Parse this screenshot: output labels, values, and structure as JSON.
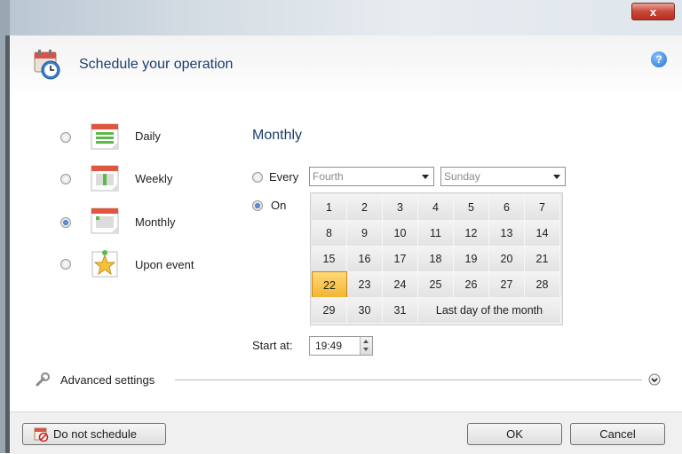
{
  "window": {
    "close_glyph": "x"
  },
  "header": {
    "title": "Schedule your operation",
    "help_glyph": "?"
  },
  "options": [
    {
      "label": "Daily",
      "checked": false,
      "icon": "calendar-daily-icon"
    },
    {
      "label": "Weekly",
      "checked": false,
      "icon": "calendar-weekly-icon"
    },
    {
      "label": "Monthly",
      "checked": true,
      "icon": "calendar-monthly-icon"
    },
    {
      "label": "Upon event",
      "checked": false,
      "icon": "event-star-icon"
    }
  ],
  "monthly": {
    "title": "Monthly",
    "every_label": "Every",
    "every_checked": false,
    "week_select": "Fourth",
    "day_select": "Sunday",
    "on_label": "On",
    "on_checked": true,
    "days": [
      "1",
      "2",
      "3",
      "4",
      "5",
      "6",
      "7",
      "8",
      "9",
      "10",
      "11",
      "12",
      "13",
      "14",
      "15",
      "16",
      "17",
      "18",
      "19",
      "20",
      "21",
      "22",
      "23",
      "24",
      "25",
      "26",
      "27",
      "28",
      "29",
      "30",
      "31"
    ],
    "last_day_label": "Last day of the month",
    "selected_day": "22",
    "start_label": "Start at:",
    "start_time": "19:49"
  },
  "advanced": {
    "label": "Advanced settings"
  },
  "footer": {
    "do_not_schedule": "Do not schedule",
    "ok": "OK",
    "cancel": "Cancel"
  },
  "colors": {
    "title_text": "#1d3d6b",
    "selected_day": "#f2b531",
    "close_button": "#c9473a"
  }
}
